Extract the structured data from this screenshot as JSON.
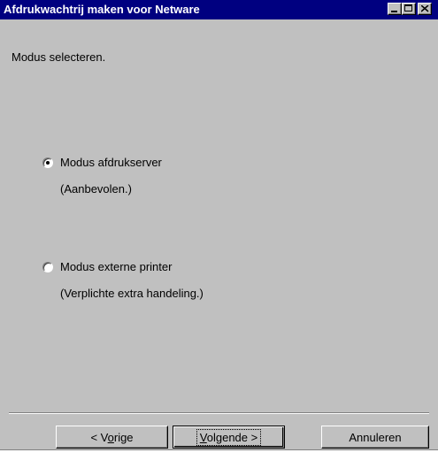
{
  "window": {
    "title": "Afdrukwachtrij maken voor Netware"
  },
  "heading": "Modus selecteren.",
  "options": [
    {
      "label": "Modus afdrukserver",
      "description": "(Aanbevolen.)",
      "selected": true
    },
    {
      "label": "Modus externe printer",
      "description": "(Verplichte extra handeling.)",
      "selected": false
    }
  ],
  "buttons": {
    "prev_pre": "< V",
    "prev_u": "o",
    "prev_post": "rige",
    "next_u": "V",
    "next_post": "olgende >",
    "cancel": "Annuleren"
  }
}
